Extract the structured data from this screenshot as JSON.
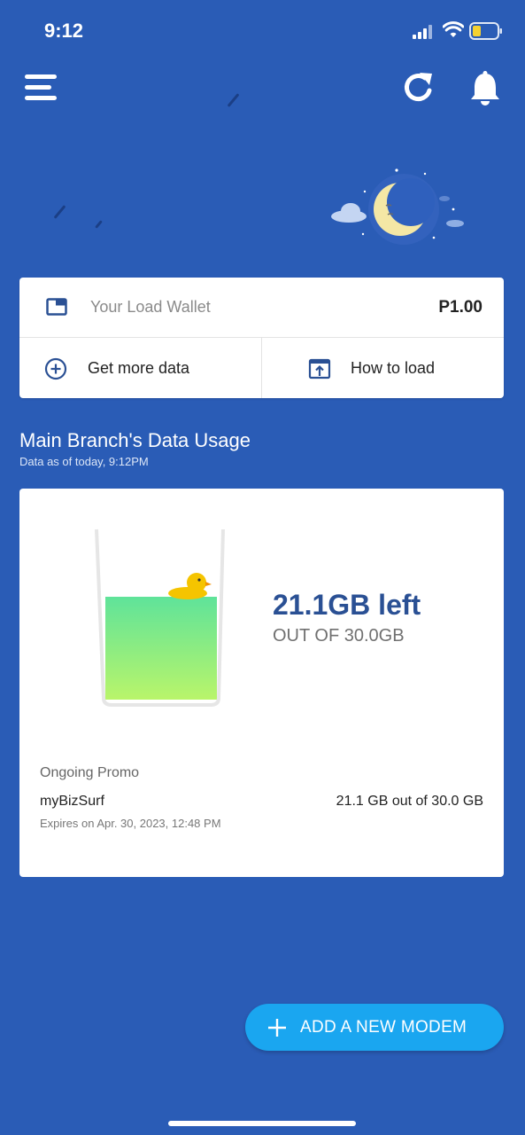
{
  "status_bar": {
    "time": "9:12"
  },
  "wallet": {
    "label": "Your Load Wallet",
    "amount": "P1.00",
    "actions": [
      {
        "label": "Get more data",
        "icon": "plus-circle-icon"
      },
      {
        "label": "How to load",
        "icon": "upload-box-icon"
      }
    ]
  },
  "usage": {
    "title": "Main Branch's Data Usage",
    "subtitle": "Data as of today, 9:12PM",
    "remaining": "21.1GB left",
    "total": "OUT OF 30.0GB",
    "remaining_fraction": 0.703,
    "promo": {
      "section_label": "Ongoing Promo",
      "name": "myBizSurf",
      "usage": "21.1 GB out of 30.0 GB",
      "expiry": "Expires on Apr. 30, 2023, 12:48 PM"
    }
  },
  "fab": {
    "label": "ADD A NEW MODEM",
    "icon": "plus-icon"
  },
  "colors": {
    "background": "#2a5cb6",
    "accent": "#1aa6f0",
    "liquid_top": "#5fe39a",
    "liquid_bottom": "#b9f56a"
  },
  "icons": {
    "menu": "hamburger-menu-icon",
    "refresh": "refresh-icon",
    "notifications": "bell-icon",
    "wallet": "wallet-icon"
  }
}
